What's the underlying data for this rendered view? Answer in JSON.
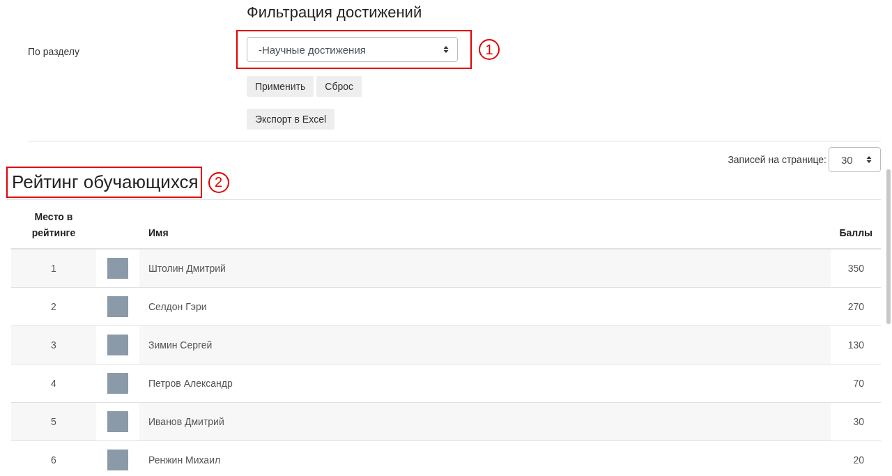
{
  "filter": {
    "title": "Фильтрация достижений",
    "field_label": "По разделу",
    "section_select": {
      "value": "-Научные достижения"
    },
    "callout": "1",
    "buttons": [
      "Применить",
      "Сброс"
    ],
    "export_button": "Экспорт в Excel"
  },
  "per_page": {
    "label": "Записей на странице:",
    "value": "30"
  },
  "rating": {
    "title": "Рейтинг обучающихся",
    "callout": "2",
    "columns": [
      "Место в рейтинге",
      "Имя",
      "Баллы"
    ],
    "rows": [
      {
        "rank": "1",
        "name": "Штолин Дмитрий",
        "score": "350"
      },
      {
        "rank": "2",
        "name": "Селдон Гэри",
        "score": "270"
      },
      {
        "rank": "3",
        "name": "Зимин Сергей",
        "score": "130"
      },
      {
        "rank": "4",
        "name": "Петров Александр",
        "score": "70"
      },
      {
        "rank": "5",
        "name": "Иванов Дмитрий",
        "score": "30"
      },
      {
        "rank": "6",
        "name": "Ренжин Михаил",
        "score": "20"
      }
    ]
  }
}
